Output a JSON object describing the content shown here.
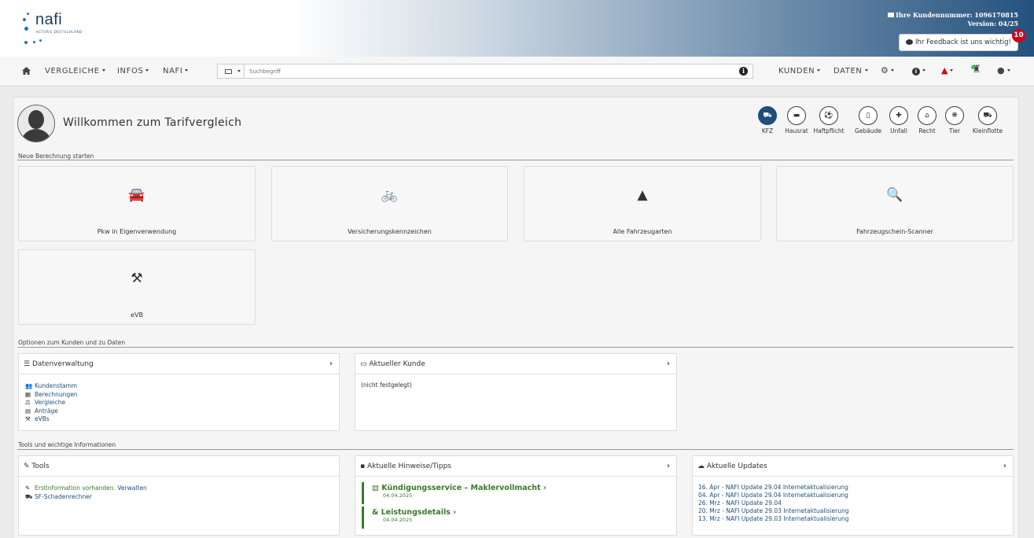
{
  "header": {
    "logo": "nafi",
    "logo_sub": "ACTURIS DEUTSCHLAND",
    "customer_number": "Ihre Kundennummer: 1096170815",
    "version": "Version: 04/25",
    "feedback_label": "Ihr Feedback ist uns wichtig!",
    "feedback_badge": "10"
  },
  "nav": {
    "left": [
      {
        "label": "VERGLEICHE"
      },
      {
        "label": "INFOS"
      },
      {
        "label": "NAFI"
      }
    ],
    "search_placeholder": "Suchbegriff",
    "right": [
      {
        "label": "KUNDEN"
      },
      {
        "label": "DATEN"
      }
    ]
  },
  "welcome": "Willkommen zum Tarifvergleich",
  "categories": [
    {
      "label": "KFZ",
      "icon": "car-icon",
      "glyph": "⛟",
      "active": true
    },
    {
      "label": "Hausrat",
      "icon": "bed-icon",
      "glyph": "▬"
    },
    {
      "label": "Haftpflicht",
      "icon": "ball-icon",
      "glyph": "⚽"
    },
    {
      "label": "Gebäude",
      "icon": "building-icon",
      "glyph": "▯"
    },
    {
      "label": "Unfall",
      "icon": "first-aid-icon",
      "glyph": "✚"
    },
    {
      "label": "Recht",
      "icon": "courthouse-icon",
      "glyph": "⌂"
    },
    {
      "label": "Tier",
      "icon": "paw-icon",
      "glyph": "❋"
    },
    {
      "label": "Kleinflotte",
      "icon": "fleet-icon",
      "glyph": "⛟"
    }
  ],
  "section_new": "Neue Berechnung starten",
  "tiles": [
    {
      "label": "Pkw in Eigenverwendung",
      "icon": "car-icon",
      "glyph": "🚘"
    },
    {
      "label": "Versicherungskennzeichen",
      "icon": "bicycle-icon",
      "glyph": "🚲"
    },
    {
      "label": "Alle Fahrzeugarten",
      "icon": "road-icon",
      "glyph": "▲"
    },
    {
      "label": "Fahrzeugschein-Scanner",
      "icon": "file-search-icon",
      "glyph": "🔍"
    },
    {
      "label": "eVB",
      "icon": "gavel-icon",
      "glyph": "⚒"
    }
  ],
  "section_options": "Optionen zum Kunden und zu Daten",
  "datenverwaltung": {
    "title": "Datenverwaltung",
    "items": [
      {
        "label": "Kundenstamm",
        "glyph": "👥"
      },
      {
        "label": "Berechnungen",
        "glyph": "▦"
      },
      {
        "label": "Vergleiche",
        "glyph": "⚖"
      },
      {
        "label": "Anträge",
        "glyph": "▤"
      },
      {
        "label": "eVBs",
        "glyph": "⚒"
      }
    ]
  },
  "aktueller_kunde": {
    "title": "Aktueller Kunde",
    "value": "(nicht festgelegt)"
  },
  "section_tools": "Tools und wichtige Informationen",
  "tools": {
    "title": "Tools",
    "item1_prefix": "Erstinformation vorhanden.",
    "item1_link": "Verwalten",
    "item2": "SF-Schadenrechner"
  },
  "hinweise": {
    "title": "Aktuelle Hinweise/Tipps",
    "items": [
      {
        "title": "Kündigungsservice – Maklervollmacht",
        "date": "04.04.2025"
      },
      {
        "title": "Leistungsdetails",
        "date": "04.04.2025"
      }
    ]
  },
  "updates": {
    "title": "Aktuelle Updates",
    "items": [
      "16. Apr - NAFI Update 29.04 Internetaktualisierung",
      "04. Apr - NAFI Update 29.04 Internetaktualisierung",
      "26. Mrz - NAFI Update 29.04",
      "20. Mrz - NAFI Update 29.03 Internetaktualisierung",
      "13. Mrz - NAFI Update 29.03 Internetaktualisierung"
    ]
  }
}
